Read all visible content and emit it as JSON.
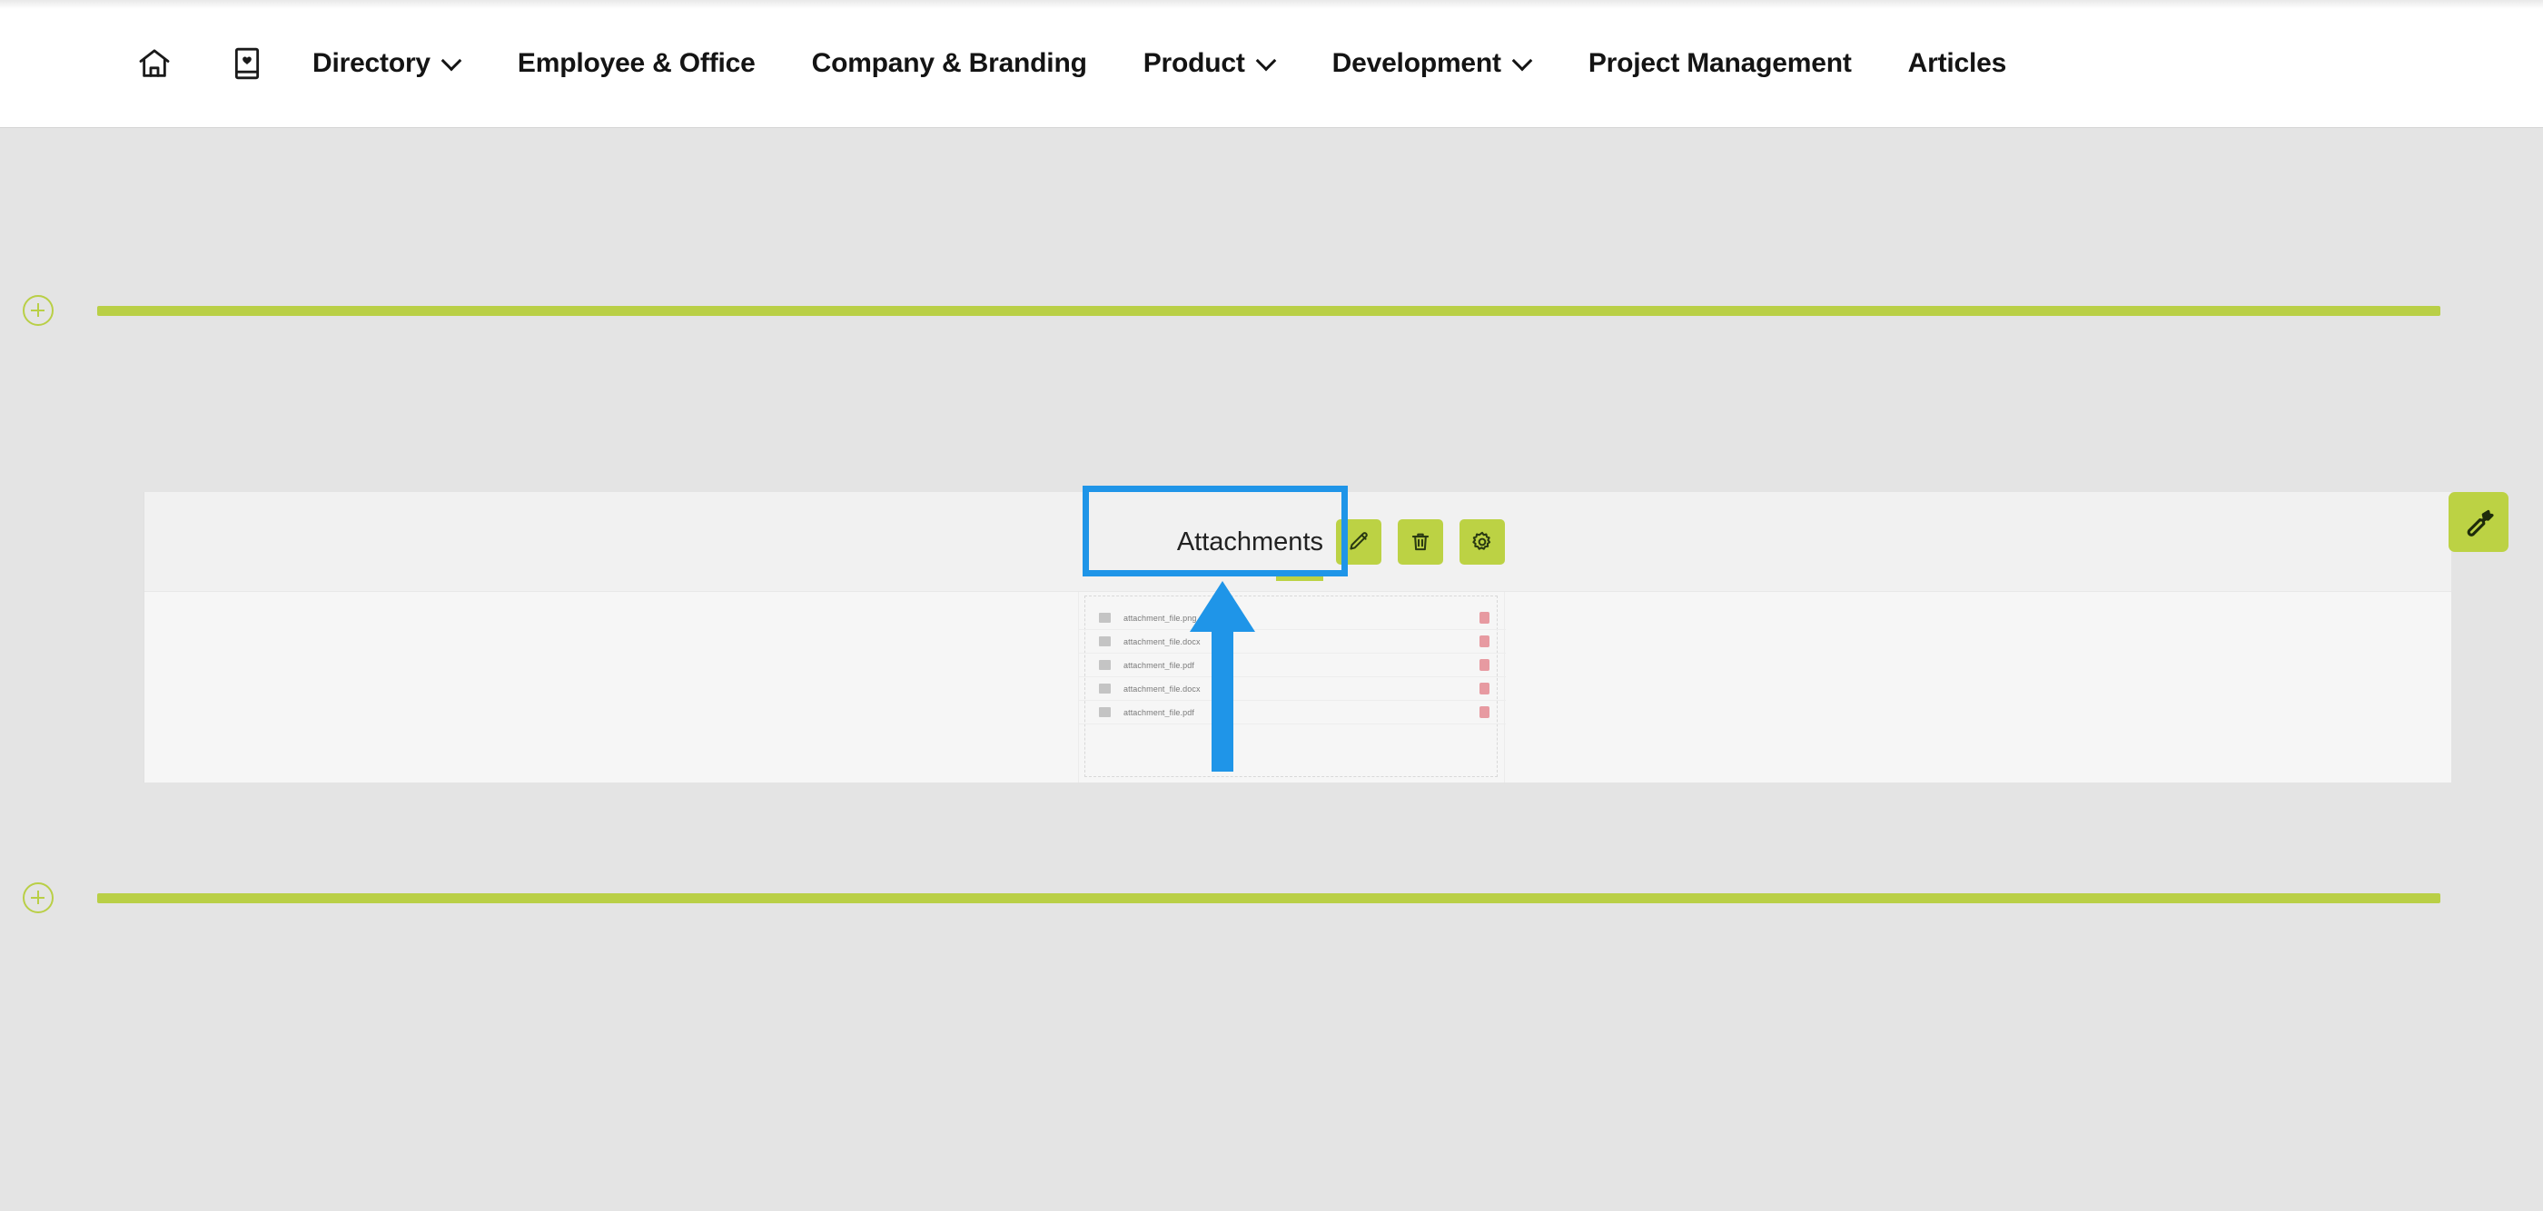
{
  "nav": {
    "icons": [
      {
        "name": "home-icon",
        "label": "Home"
      },
      {
        "name": "favorites-book-icon",
        "label": "Favorites"
      }
    ],
    "items": [
      {
        "label": "Directory",
        "has_dropdown": true
      },
      {
        "label": "Employee & Office",
        "has_dropdown": false
      },
      {
        "label": "Company & Branding",
        "has_dropdown": false
      },
      {
        "label": "Product",
        "has_dropdown": true
      },
      {
        "label": "Development",
        "has_dropdown": true
      },
      {
        "label": "Project Management",
        "has_dropdown": false
      },
      {
        "label": "Articles",
        "has_dropdown": false
      }
    ]
  },
  "layout": {
    "add_section_top_label": "Add section",
    "add_section_bottom_label": "Add section"
  },
  "widget": {
    "title": "Attachments",
    "buttons": [
      {
        "name": "edit-widget-button",
        "icon": "pencil-icon",
        "label": "Edit"
      },
      {
        "name": "delete-widget-button",
        "icon": "trash-icon",
        "label": "Delete"
      },
      {
        "name": "settings-widget-button",
        "icon": "gear-icon",
        "label": "Settings"
      }
    ],
    "files": [
      {
        "name": "attachment_file.png"
      },
      {
        "name": "attachment_file.docx"
      },
      {
        "name": "attachment_file.pdf"
      },
      {
        "name": "attachment_file.docx"
      },
      {
        "name": "attachment_file.pdf"
      }
    ]
  },
  "tools": {
    "wrench_label": "Page tools"
  },
  "annotation": {
    "highlight_target": "Attachments widget title and edit button",
    "arrow_direction": "up"
  },
  "colors": {
    "accent_green": "#bcd244",
    "highlight_blue": "#1f95e8",
    "page_bg": "#e4e4e4",
    "panel_bg": "#f1f1f1",
    "delete_red": "#e48a92"
  }
}
